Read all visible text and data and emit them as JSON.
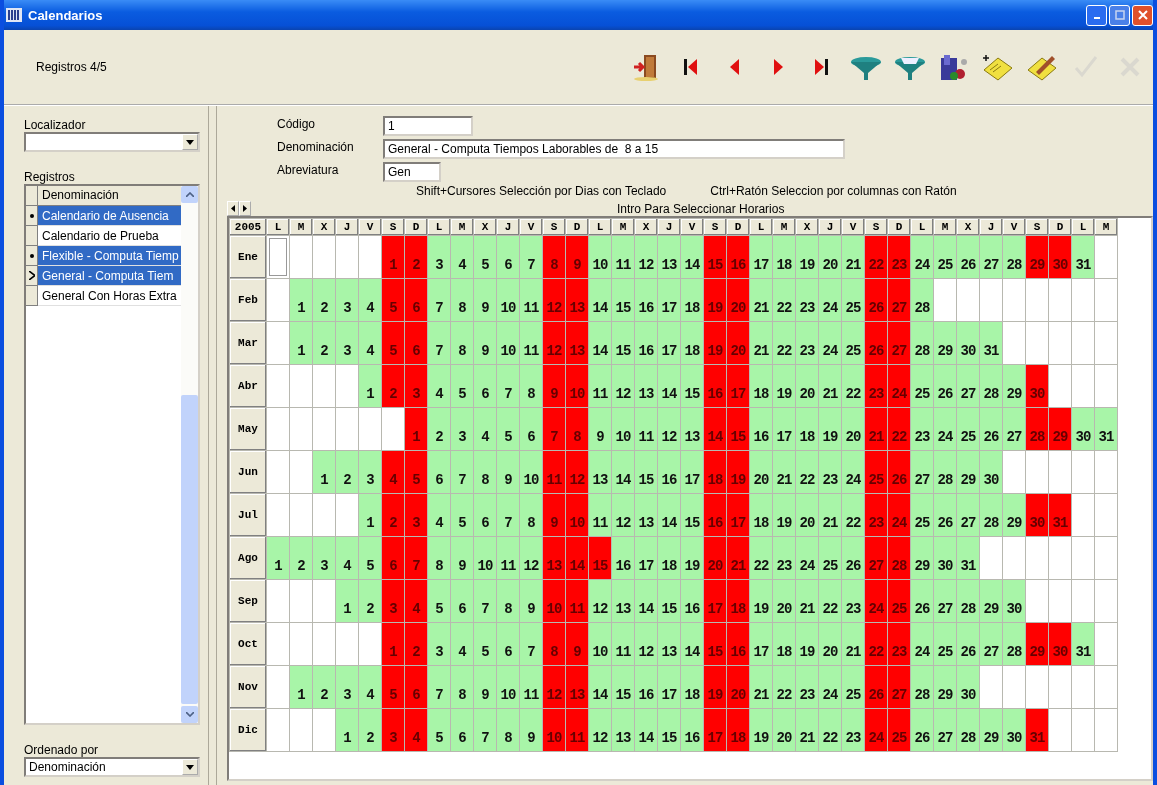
{
  "window": {
    "title": "Calendarios"
  },
  "toolbar": {
    "record_count": "Registros 4/5",
    "buttons": [
      {
        "kind": "exit",
        "disabled": false
      },
      {
        "kind": "first",
        "disabled": false
      },
      {
        "kind": "prev",
        "disabled": false
      },
      {
        "kind": "next",
        "disabled": false
      },
      {
        "kind": "last",
        "disabled": false
      },
      {
        "kind": "filter",
        "disabled": false
      },
      {
        "kind": "filter-clear",
        "disabled": false
      },
      {
        "kind": "report",
        "disabled": false
      },
      {
        "kind": "add",
        "disabled": false
      },
      {
        "kind": "edit",
        "disabled": false
      },
      {
        "kind": "accept",
        "disabled": true
      },
      {
        "kind": "cancel",
        "disabled": true
      }
    ]
  },
  "locator": {
    "label": "Localizador"
  },
  "records": {
    "label": "Registros",
    "column": "Denominación",
    "rows": [
      {
        "text": "Calendario de Ausencia",
        "selected": true,
        "bookmarked": true,
        "current": false
      },
      {
        "text": "Calendario de Prueba",
        "selected": false,
        "bookmarked": false,
        "current": false
      },
      {
        "text": "Flexible - Computa Tiemp",
        "selected": true,
        "bookmarked": true,
        "current": false
      },
      {
        "text": "General - Computa Tiem",
        "selected": true,
        "bookmarked": false,
        "current": true
      },
      {
        "text": "General Con Horas Extra",
        "selected": false,
        "bookmarked": false,
        "current": false
      }
    ]
  },
  "sort": {
    "label": "Ordenado por",
    "value": "Denominación"
  },
  "form": {
    "fields": [
      {
        "label": "Código",
        "value": "1"
      },
      {
        "label": "Denominación",
        "value": "General - Computa Tiempos Laborables de  8 a 15"
      },
      {
        "label": "Abreviatura",
        "value": "Gen"
      }
    ],
    "hint_keyboard": "Shift+Cursores Selección por Dias con Teclado",
    "hint_mouse": "Ctrl+Ratón Seleccion por columnas con Ratón",
    "hint_enter": "Intro Para Seleccionar Horarios"
  },
  "calendar": {
    "year": "2005",
    "weekdays": [
      "L",
      "M",
      "X",
      "J",
      "V",
      "S",
      "D",
      "L",
      "M",
      "X",
      "J",
      "V",
      "S",
      "D",
      "L",
      "M",
      "X",
      "J",
      "V",
      "S",
      "D",
      "L",
      "M",
      "X",
      "J",
      "V",
      "S",
      "D",
      "L",
      "M",
      "X",
      "J",
      "V",
      "S",
      "D",
      "L",
      "M"
    ],
    "months": [
      {
        "label": "Ene",
        "cells": [
          {
            "focused": true
          },
          null,
          null,
          null,
          null,
          {
            "day": "1",
            "holiday": true
          },
          {
            "day": "2",
            "holiday": true
          },
          {
            "day": "3",
            "holiday": false
          },
          {
            "day": "4",
            "holiday": false
          },
          {
            "day": "5",
            "holiday": false
          },
          {
            "day": "6",
            "holiday": false
          },
          {
            "day": "7",
            "holiday": false
          },
          {
            "day": "8",
            "holiday": true
          },
          {
            "day": "9",
            "holiday": true
          },
          {
            "day": "10",
            "holiday": false
          },
          {
            "day": "11",
            "holiday": false
          },
          {
            "day": "12",
            "holiday": false
          },
          {
            "day": "13",
            "holiday": false
          },
          {
            "day": "14",
            "holiday": false
          },
          {
            "day": "15",
            "holiday": true
          },
          {
            "day": "16",
            "holiday": true
          },
          {
            "day": "17",
            "holiday": false
          },
          {
            "day": "18",
            "holiday": false
          },
          {
            "day": "19",
            "holiday": false
          },
          {
            "day": "20",
            "holiday": false
          },
          {
            "day": "21",
            "holiday": false
          },
          {
            "day": "22",
            "holiday": true
          },
          {
            "day": "23",
            "holiday": true
          },
          {
            "day": "24",
            "holiday": false
          },
          {
            "day": "25",
            "holiday": false
          },
          {
            "day": "26",
            "holiday": false
          },
          {
            "day": "27",
            "holiday": false
          },
          {
            "day": "28",
            "holiday": false
          },
          {
            "day": "29",
            "holiday": true
          },
          {
            "day": "30",
            "holiday": true
          },
          {
            "day": "31",
            "holiday": false
          }
        ]
      },
      {
        "label": "Feb",
        "cells": [
          null,
          {
            "day": "1",
            "holiday": false
          },
          {
            "day": "2",
            "holiday": false
          },
          {
            "day": "3",
            "holiday": false
          },
          {
            "day": "4",
            "holiday": false
          },
          {
            "day": "5",
            "holiday": true
          },
          {
            "day": "6",
            "holiday": true
          },
          {
            "day": "7",
            "holiday": false
          },
          {
            "day": "8",
            "holiday": false
          },
          {
            "day": "9",
            "holiday": false
          },
          {
            "day": "10",
            "holiday": false
          },
          {
            "day": "11",
            "holiday": false
          },
          {
            "day": "12",
            "holiday": true
          },
          {
            "day": "13",
            "holiday": true
          },
          {
            "day": "14",
            "holiday": false
          },
          {
            "day": "15",
            "holiday": false
          },
          {
            "day": "16",
            "holiday": false
          },
          {
            "day": "17",
            "holiday": false
          },
          {
            "day": "18",
            "holiday": false
          },
          {
            "day": "19",
            "holiday": true
          },
          {
            "day": "20",
            "holiday": true
          },
          {
            "day": "21",
            "holiday": false
          },
          {
            "day": "22",
            "holiday": false
          },
          {
            "day": "23",
            "holiday": false
          },
          {
            "day": "24",
            "holiday": false
          },
          {
            "day": "25",
            "holiday": false
          },
          {
            "day": "26",
            "holiday": true
          },
          {
            "day": "27",
            "holiday": true
          },
          {
            "day": "28",
            "holiday": false
          }
        ]
      },
      {
        "label": "Mar",
        "cells": [
          null,
          {
            "day": "1",
            "holiday": false
          },
          {
            "day": "2",
            "holiday": false
          },
          {
            "day": "3",
            "holiday": false
          },
          {
            "day": "4",
            "holiday": false
          },
          {
            "day": "5",
            "holiday": true
          },
          {
            "day": "6",
            "holiday": true
          },
          {
            "day": "7",
            "holiday": false
          },
          {
            "day": "8",
            "holiday": false
          },
          {
            "day": "9",
            "holiday": false
          },
          {
            "day": "10",
            "holiday": false
          },
          {
            "day": "11",
            "holiday": false
          },
          {
            "day": "12",
            "holiday": true
          },
          {
            "day": "13",
            "holiday": true
          },
          {
            "day": "14",
            "holiday": false
          },
          {
            "day": "15",
            "holiday": false
          },
          {
            "day": "16",
            "holiday": false
          },
          {
            "day": "17",
            "holiday": false
          },
          {
            "day": "18",
            "holiday": false
          },
          {
            "day": "19",
            "holiday": true
          },
          {
            "day": "20",
            "holiday": true
          },
          {
            "day": "21",
            "holiday": false
          },
          {
            "day": "22",
            "holiday": false
          },
          {
            "day": "23",
            "holiday": false
          },
          {
            "day": "24",
            "holiday": false
          },
          {
            "day": "25",
            "holiday": false
          },
          {
            "day": "26",
            "holiday": true
          },
          {
            "day": "27",
            "holiday": true
          },
          {
            "day": "28",
            "holiday": false
          },
          {
            "day": "29",
            "holiday": false
          },
          {
            "day": "30",
            "holiday": false
          },
          {
            "day": "31",
            "holiday": false
          }
        ]
      },
      {
        "label": "Abr",
        "cells": [
          null,
          null,
          null,
          null,
          {
            "day": "1",
            "holiday": false
          },
          {
            "day": "2",
            "holiday": true
          },
          {
            "day": "3",
            "holiday": true
          },
          {
            "day": "4",
            "holiday": false
          },
          {
            "day": "5",
            "holiday": false
          },
          {
            "day": "6",
            "holiday": false
          },
          {
            "day": "7",
            "holiday": false
          },
          {
            "day": "8",
            "holiday": false
          },
          {
            "day": "9",
            "holiday": true
          },
          {
            "day": "10",
            "holiday": true
          },
          {
            "day": "11",
            "holiday": false
          },
          {
            "day": "12",
            "holiday": false
          },
          {
            "day": "13",
            "holiday": false
          },
          {
            "day": "14",
            "holiday": false
          },
          {
            "day": "15",
            "holiday": false
          },
          {
            "day": "16",
            "holiday": true
          },
          {
            "day": "17",
            "holiday": true
          },
          {
            "day": "18",
            "holiday": false
          },
          {
            "day": "19",
            "holiday": false
          },
          {
            "day": "20",
            "holiday": false
          },
          {
            "day": "21",
            "holiday": false
          },
          {
            "day": "22",
            "holiday": false
          },
          {
            "day": "23",
            "holiday": true
          },
          {
            "day": "24",
            "holiday": true
          },
          {
            "day": "25",
            "holiday": false
          },
          {
            "day": "26",
            "holiday": false
          },
          {
            "day": "27",
            "holiday": false
          },
          {
            "day": "28",
            "holiday": false
          },
          {
            "day": "29",
            "holiday": false
          },
          {
            "day": "30",
            "holiday": true
          }
        ]
      },
      {
        "label": "May",
        "cells": [
          null,
          null,
          null,
          null,
          null,
          null,
          {
            "day": "1",
            "holiday": true
          },
          {
            "day": "2",
            "holiday": false
          },
          {
            "day": "3",
            "holiday": false
          },
          {
            "day": "4",
            "holiday": false
          },
          {
            "day": "5",
            "holiday": false
          },
          {
            "day": "6",
            "holiday": false
          },
          {
            "day": "7",
            "holiday": true
          },
          {
            "day": "8",
            "holiday": true
          },
          {
            "day": "9",
            "holiday": false
          },
          {
            "day": "10",
            "holiday": false
          },
          {
            "day": "11",
            "holiday": false
          },
          {
            "day": "12",
            "holiday": false
          },
          {
            "day": "13",
            "holiday": false
          },
          {
            "day": "14",
            "holiday": true
          },
          {
            "day": "15",
            "holiday": true
          },
          {
            "day": "16",
            "holiday": false
          },
          {
            "day": "17",
            "holiday": false
          },
          {
            "day": "18",
            "holiday": false
          },
          {
            "day": "19",
            "holiday": false
          },
          {
            "day": "20",
            "holiday": false
          },
          {
            "day": "21",
            "holiday": true
          },
          {
            "day": "22",
            "holiday": true
          },
          {
            "day": "23",
            "holiday": false
          },
          {
            "day": "24",
            "holiday": false
          },
          {
            "day": "25",
            "holiday": false
          },
          {
            "day": "26",
            "holiday": false
          },
          {
            "day": "27",
            "holiday": false
          },
          {
            "day": "28",
            "holiday": true
          },
          {
            "day": "29",
            "holiday": true
          },
          {
            "day": "30",
            "holiday": false
          },
          {
            "day": "31",
            "holiday": false
          }
        ]
      },
      {
        "label": "Jun",
        "cells": [
          null,
          null,
          {
            "day": "1",
            "holiday": false
          },
          {
            "day": "2",
            "holiday": false
          },
          {
            "day": "3",
            "holiday": false
          },
          {
            "day": "4",
            "holiday": true
          },
          {
            "day": "5",
            "holiday": true
          },
          {
            "day": "6",
            "holiday": false
          },
          {
            "day": "7",
            "holiday": false
          },
          {
            "day": "8",
            "holiday": false
          },
          {
            "day": "9",
            "holiday": false
          },
          {
            "day": "10",
            "holiday": false
          },
          {
            "day": "11",
            "holiday": true
          },
          {
            "day": "12",
            "holiday": true
          },
          {
            "day": "13",
            "holiday": false
          },
          {
            "day": "14",
            "holiday": false
          },
          {
            "day": "15",
            "holiday": false
          },
          {
            "day": "16",
            "holiday": false
          },
          {
            "day": "17",
            "holiday": false
          },
          {
            "day": "18",
            "holiday": true
          },
          {
            "day": "19",
            "holiday": true
          },
          {
            "day": "20",
            "holiday": false
          },
          {
            "day": "21",
            "holiday": false
          },
          {
            "day": "22",
            "holiday": false
          },
          {
            "day": "23",
            "holiday": false
          },
          {
            "day": "24",
            "holiday": false
          },
          {
            "day": "25",
            "holiday": true
          },
          {
            "day": "26",
            "holiday": true
          },
          {
            "day": "27",
            "holiday": false
          },
          {
            "day": "28",
            "holiday": false
          },
          {
            "day": "29",
            "holiday": false
          },
          {
            "day": "30",
            "holiday": false
          }
        ]
      },
      {
        "label": "Jul",
        "cells": [
          null,
          null,
          null,
          null,
          {
            "day": "1",
            "holiday": false
          },
          {
            "day": "2",
            "holiday": true
          },
          {
            "day": "3",
            "holiday": true
          },
          {
            "day": "4",
            "holiday": false
          },
          {
            "day": "5",
            "holiday": false
          },
          {
            "day": "6",
            "holiday": false
          },
          {
            "day": "7",
            "holiday": false
          },
          {
            "day": "8",
            "holiday": false
          },
          {
            "day": "9",
            "holiday": true
          },
          {
            "day": "10",
            "holiday": true
          },
          {
            "day": "11",
            "holiday": false
          },
          {
            "day": "12",
            "holiday": false
          },
          {
            "day": "13",
            "holiday": false
          },
          {
            "day": "14",
            "holiday": false
          },
          {
            "day": "15",
            "holiday": false
          },
          {
            "day": "16",
            "holiday": true
          },
          {
            "day": "17",
            "holiday": true
          },
          {
            "day": "18",
            "holiday": false
          },
          {
            "day": "19",
            "holiday": false
          },
          {
            "day": "20",
            "holiday": false
          },
          {
            "day": "21",
            "holiday": false
          },
          {
            "day": "22",
            "holiday": false
          },
          {
            "day": "23",
            "holiday": true
          },
          {
            "day": "24",
            "holiday": true
          },
          {
            "day": "25",
            "holiday": false
          },
          {
            "day": "26",
            "holiday": false
          },
          {
            "day": "27",
            "holiday": false
          },
          {
            "day": "28",
            "holiday": false
          },
          {
            "day": "29",
            "holiday": false
          },
          {
            "day": "30",
            "holiday": true
          },
          {
            "day": "31",
            "holiday": true
          }
        ]
      },
      {
        "label": "Ago",
        "cells": [
          {
            "day": "1",
            "holiday": false
          },
          {
            "day": "2",
            "holiday": false
          },
          {
            "day": "3",
            "holiday": false
          },
          {
            "day": "4",
            "holiday": false
          },
          {
            "day": "5",
            "holiday": false
          },
          {
            "day": "6",
            "holiday": true
          },
          {
            "day": "7",
            "holiday": true
          },
          {
            "day": "8",
            "holiday": false
          },
          {
            "day": "9",
            "holiday": false
          },
          {
            "day": "10",
            "holiday": false
          },
          {
            "day": "11",
            "holiday": false
          },
          {
            "day": "12",
            "holiday": false
          },
          {
            "day": "13",
            "holiday": true
          },
          {
            "day": "14",
            "holiday": true
          },
          {
            "day": "15",
            "holiday": true
          },
          {
            "day": "16",
            "holiday": false
          },
          {
            "day": "17",
            "holiday": false
          },
          {
            "day": "18",
            "holiday": false
          },
          {
            "day": "19",
            "holiday": false
          },
          {
            "day": "20",
            "holiday": true
          },
          {
            "day": "21",
            "holiday": true
          },
          {
            "day": "22",
            "holiday": false
          },
          {
            "day": "23",
            "holiday": false
          },
          {
            "day": "24",
            "holiday": false
          },
          {
            "day": "25",
            "holiday": false
          },
          {
            "day": "26",
            "holiday": false
          },
          {
            "day": "27",
            "holiday": true
          },
          {
            "day": "28",
            "holiday": true
          },
          {
            "day": "29",
            "holiday": false
          },
          {
            "day": "30",
            "holiday": false
          },
          {
            "day": "31",
            "holiday": false
          }
        ]
      },
      {
        "label": "Sep",
        "cells": [
          null,
          null,
          null,
          {
            "day": "1",
            "holiday": false
          },
          {
            "day": "2",
            "holiday": false
          },
          {
            "day": "3",
            "holiday": true
          },
          {
            "day": "4",
            "holiday": true
          },
          {
            "day": "5",
            "holiday": false
          },
          {
            "day": "6",
            "holiday": false
          },
          {
            "day": "7",
            "holiday": false
          },
          {
            "day": "8",
            "holiday": false
          },
          {
            "day": "9",
            "holiday": false
          },
          {
            "day": "10",
            "holiday": true
          },
          {
            "day": "11",
            "holiday": true
          },
          {
            "day": "12",
            "holiday": false
          },
          {
            "day": "13",
            "holiday": false
          },
          {
            "day": "14",
            "holiday": false
          },
          {
            "day": "15",
            "holiday": false
          },
          {
            "day": "16",
            "holiday": false
          },
          {
            "day": "17",
            "holiday": true
          },
          {
            "day": "18",
            "holiday": true
          },
          {
            "day": "19",
            "holiday": false
          },
          {
            "day": "20",
            "holiday": false
          },
          {
            "day": "21",
            "holiday": false
          },
          {
            "day": "22",
            "holiday": false
          },
          {
            "day": "23",
            "holiday": false
          },
          {
            "day": "24",
            "holiday": true
          },
          {
            "day": "25",
            "holiday": true
          },
          {
            "day": "26",
            "holiday": false
          },
          {
            "day": "27",
            "holiday": false
          },
          {
            "day": "28",
            "holiday": false
          },
          {
            "day": "29",
            "holiday": false
          },
          {
            "day": "30",
            "holiday": false
          }
        ]
      },
      {
        "label": "Oct",
        "cells": [
          null,
          null,
          null,
          null,
          null,
          {
            "day": "1",
            "holiday": true
          },
          {
            "day": "2",
            "holiday": true
          },
          {
            "day": "3",
            "holiday": false
          },
          {
            "day": "4",
            "holiday": false
          },
          {
            "day": "5",
            "holiday": false
          },
          {
            "day": "6",
            "holiday": false
          },
          {
            "day": "7",
            "holiday": false
          },
          {
            "day": "8",
            "holiday": true
          },
          {
            "day": "9",
            "holiday": true
          },
          {
            "day": "10",
            "holiday": false
          },
          {
            "day": "11",
            "holiday": false
          },
          {
            "day": "12",
            "holiday": false
          },
          {
            "day": "13",
            "holiday": false
          },
          {
            "day": "14",
            "holiday": false
          },
          {
            "day": "15",
            "holiday": true
          },
          {
            "day": "16",
            "holiday": true
          },
          {
            "day": "17",
            "holiday": false
          },
          {
            "day": "18",
            "holiday": false
          },
          {
            "day": "19",
            "holiday": false
          },
          {
            "day": "20",
            "holiday": false
          },
          {
            "day": "21",
            "holiday": false
          },
          {
            "day": "22",
            "holiday": true
          },
          {
            "day": "23",
            "holiday": true
          },
          {
            "day": "24",
            "holiday": false
          },
          {
            "day": "25",
            "holiday": false
          },
          {
            "day": "26",
            "holiday": false
          },
          {
            "day": "27",
            "holiday": false
          },
          {
            "day": "28",
            "holiday": false
          },
          {
            "day": "29",
            "holiday": true
          },
          {
            "day": "30",
            "holiday": true
          },
          {
            "day": "31",
            "holiday": false
          }
        ]
      },
      {
        "label": "Nov",
        "cells": [
          null,
          {
            "day": "1",
            "holiday": false
          },
          {
            "day": "2",
            "holiday": false
          },
          {
            "day": "3",
            "holiday": false
          },
          {
            "day": "4",
            "holiday": false
          },
          {
            "day": "5",
            "holiday": true
          },
          {
            "day": "6",
            "holiday": true
          },
          {
            "day": "7",
            "holiday": false
          },
          {
            "day": "8",
            "holiday": false
          },
          {
            "day": "9",
            "holiday": false
          },
          {
            "day": "10",
            "holiday": false
          },
          {
            "day": "11",
            "holiday": false
          },
          {
            "day": "12",
            "holiday": true
          },
          {
            "day": "13",
            "holiday": true
          },
          {
            "day": "14",
            "holiday": false
          },
          {
            "day": "15",
            "holiday": false
          },
          {
            "day": "16",
            "holiday": false
          },
          {
            "day": "17",
            "holiday": false
          },
          {
            "day": "18",
            "holiday": false
          },
          {
            "day": "19",
            "holiday": true
          },
          {
            "day": "20",
            "holiday": true
          },
          {
            "day": "21",
            "holiday": false
          },
          {
            "day": "22",
            "holiday": false
          },
          {
            "day": "23",
            "holiday": false
          },
          {
            "day": "24",
            "holiday": false
          },
          {
            "day": "25",
            "holiday": false
          },
          {
            "day": "26",
            "holiday": true
          },
          {
            "day": "27",
            "holiday": true
          },
          {
            "day": "28",
            "holiday": false
          },
          {
            "day": "29",
            "holiday": false
          },
          {
            "day": "30",
            "holiday": false
          }
        ]
      },
      {
        "label": "Dic",
        "cells": [
          null,
          null,
          null,
          {
            "day": "1",
            "holiday": false
          },
          {
            "day": "2",
            "holiday": false
          },
          {
            "day": "3",
            "holiday": true
          },
          {
            "day": "4",
            "holiday": true
          },
          {
            "day": "5",
            "holiday": false
          },
          {
            "day": "6",
            "holiday": false
          },
          {
            "day": "7",
            "holiday": false
          },
          {
            "day": "8",
            "holiday": false
          },
          {
            "day": "9",
            "holiday": false
          },
          {
            "day": "10",
            "holiday": true
          },
          {
            "day": "11",
            "holiday": true
          },
          {
            "day": "12",
            "holiday": false
          },
          {
            "day": "13",
            "holiday": false
          },
          {
            "day": "14",
            "holiday": false
          },
          {
            "day": "15",
            "holiday": false
          },
          {
            "day": "16",
            "holiday": false
          },
          {
            "day": "17",
            "holiday": true
          },
          {
            "day": "18",
            "holiday": true
          },
          {
            "day": "19",
            "holiday": false
          },
          {
            "day": "20",
            "holiday": false
          },
          {
            "day": "21",
            "holiday": false
          },
          {
            "day": "22",
            "holiday": false
          },
          {
            "day": "23",
            "holiday": false
          },
          {
            "day": "24",
            "holiday": true
          },
          {
            "day": "25",
            "holiday": true
          },
          {
            "day": "26",
            "holiday": false
          },
          {
            "day": "27",
            "holiday": false
          },
          {
            "day": "28",
            "holiday": false
          },
          {
            "day": "29",
            "holiday": false
          },
          {
            "day": "30",
            "holiday": false
          },
          {
            "day": "31",
            "holiday": true
          }
        ]
      }
    ]
  }
}
